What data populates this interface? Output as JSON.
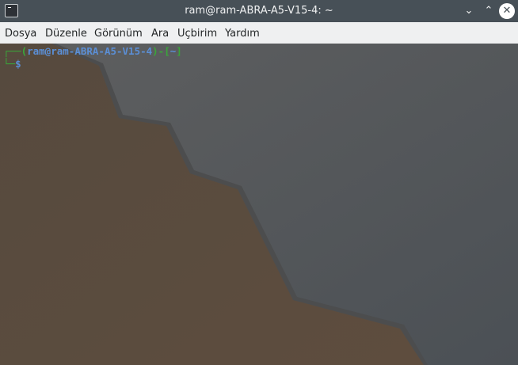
{
  "window": {
    "title": "ram@ram-ABRA-A5-V15-4: ~",
    "minimize": "⌄",
    "maximize": "⌃",
    "close": "✕"
  },
  "menu": [
    "Dosya",
    "Düzenle",
    "Görünüm",
    "Ara",
    "Uçbirim",
    "Yardım"
  ],
  "prompt": {
    "open": "┌──(",
    "user_host": "ram@ram-ABRA-A5-V15-4",
    "mid": ")-[",
    "cwd": "~",
    "close": "]",
    "corner": "└─",
    "symbol": "$"
  },
  "colors": {
    "titlebar": "#475057",
    "menubar": "#eff0f1",
    "prompt_green": "#3aa63a",
    "prompt_blue": "#5b8fd6"
  }
}
